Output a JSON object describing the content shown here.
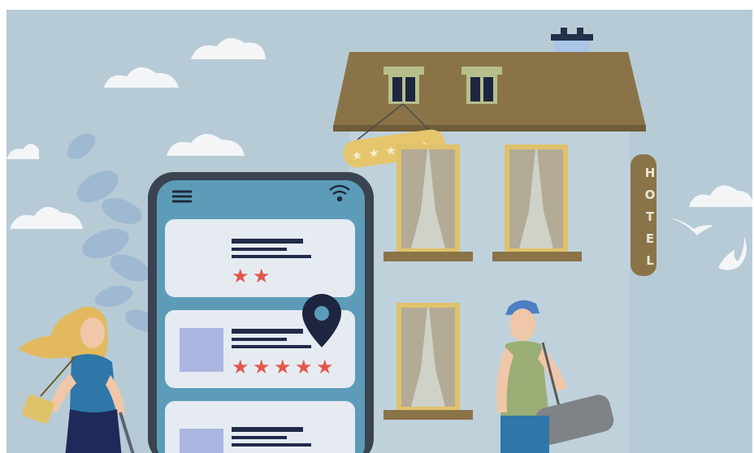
{
  "illustration": {
    "subject": "hotel-booking-app-illustration",
    "hotel_sign": {
      "letters": [
        "H",
        "O",
        "T",
        "E",
        "L"
      ]
    },
    "phone": {
      "cards": [
        {
          "stars": 2,
          "has_thumbnail": false
        },
        {
          "stars": 5,
          "has_thumbnail": true
        },
        {
          "stars": 0,
          "has_thumbnail": true
        }
      ]
    },
    "roof_badge_stars": 5,
    "colors": {
      "sky": "#b7cbd6",
      "roof": "#8a7447",
      "wall": "#bfd2dc",
      "window_frame": "#e0c26a",
      "curtain": "#b3ab96",
      "phone_body": "#3a4450",
      "phone_screen": "#5d9cb9",
      "card": "#e6ebf2",
      "star": "#e2574c",
      "pin": "#1e2540",
      "sign": "#8a7447"
    }
  }
}
